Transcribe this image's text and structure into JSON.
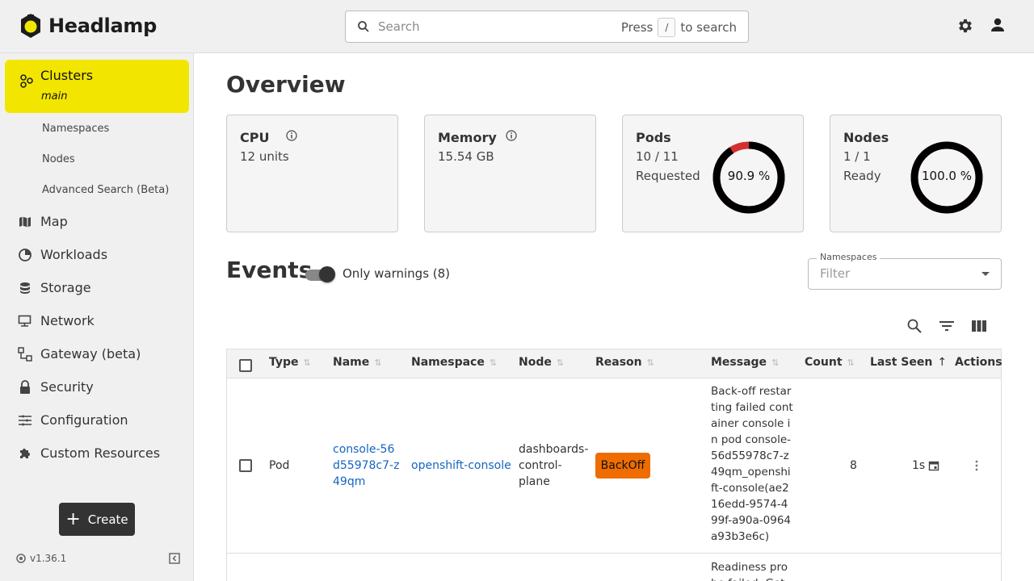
{
  "header": {
    "app_name": "Headlamp",
    "search_placeholder": "Search",
    "search_hint_press": "Press",
    "search_hint_key": "/",
    "search_hint_suffix": "to search"
  },
  "sidebar": {
    "active": {
      "label": "Clusters",
      "sublabel": "main"
    },
    "subitems": [
      "Namespaces",
      "Nodes",
      "Advanced Search (Beta)"
    ],
    "items": [
      {
        "label": "Map",
        "icon": "map-icon"
      },
      {
        "label": "Workloads",
        "icon": "workloads-icon"
      },
      {
        "label": "Storage",
        "icon": "storage-icon"
      },
      {
        "label": "Network",
        "icon": "network-icon"
      },
      {
        "label": "Gateway (beta)",
        "icon": "gateway-icon"
      },
      {
        "label": "Security",
        "icon": "lock-icon"
      },
      {
        "label": "Configuration",
        "icon": "configuration-icon"
      },
      {
        "label": "Custom Resources",
        "icon": "puzzle-icon"
      }
    ],
    "create_label": "Create",
    "version": "v1.36.1"
  },
  "overview": {
    "title": "Overview",
    "cpu": {
      "title": "CPU",
      "value": "12 units"
    },
    "memory": {
      "title": "Memory",
      "value": "15.54 GB"
    },
    "pods": {
      "title": "Pods",
      "line1": "10 / 11",
      "line2": "Requested",
      "percent_label": "90.9 %",
      "fraction": 0.909
    },
    "nodes": {
      "title": "Nodes",
      "line1": "1 / 1",
      "line2": "Ready",
      "percent_label": "100.0 %",
      "fraction": 1.0
    }
  },
  "events": {
    "title": "Events",
    "toggle_label": "Only warnings (8)",
    "toggle_on": true,
    "filter_legend": "Namespaces",
    "filter_placeholder": "Filter",
    "columns": [
      "Type",
      "Name",
      "Namespace",
      "Node",
      "Reason",
      "Message",
      "Count",
      "Last Seen",
      "Actions"
    ],
    "rows": [
      {
        "type": "Pod",
        "name": "console-56d55978c7-z49qm",
        "namespace": "openshift-console",
        "node": "dashboards-control-plane",
        "reason": "BackOff",
        "message": "Back-off restarting failed container console in pod console-56d55978c7-z49qm_openshift-console(ae216edd-9574-499f-a90a-0964a93b3e6c)",
        "count": "8",
        "last_seen": "1s"
      },
      {
        "message": "Readiness probe failed: Get \"ht"
      }
    ]
  },
  "colors": {
    "accent_yellow": "#f2e600",
    "backoff_orange": "#ef6c00",
    "link_blue": "#1565c0",
    "donut_red": "#d32f2f"
  }
}
